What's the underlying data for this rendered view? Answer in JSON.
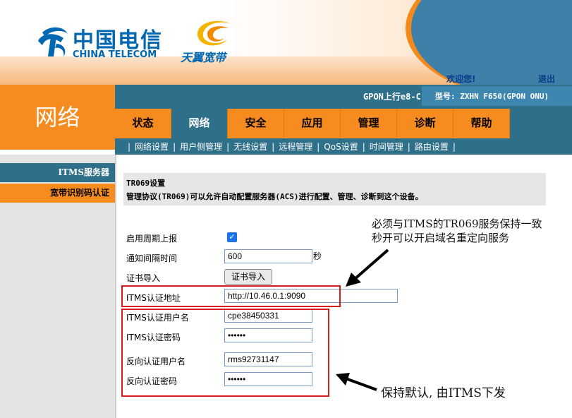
{
  "header": {
    "brand_cn": "中国电信",
    "brand_en": "CHINA TELECOM",
    "sub_brand": "天翼宽带",
    "welcome": "欢迎您!",
    "logout": "退出"
  },
  "section_title": "网络",
  "status_bar": {
    "gpon": "GPON上行e8-C",
    "model": "型号: ZXHN F650(GPON ONU)"
  },
  "nav": {
    "tabs": [
      "状态",
      "网络",
      "安全",
      "应用",
      "管理",
      "诊断",
      "帮助"
    ],
    "active": "网络"
  },
  "subnav": [
    "网络设置",
    "用户侧管理",
    "无线设置",
    "远程管理",
    "QoS设置",
    "时间管理",
    "路由设置"
  ],
  "sidebar": {
    "items": [
      "ITMS服务器",
      "宽带识别码认证"
    ]
  },
  "info": {
    "title": "TR069设置",
    "description": "管理协议(TR069)可以允许自动配置服务器(ACS)进行配置、管理、诊断到这个设备。"
  },
  "form": {
    "periodic_report_label": "启用周期上报",
    "periodic_report_checked": true,
    "notify_interval_label": "通知间隔时间",
    "notify_interval_value": "600",
    "notify_interval_unit": "秒",
    "cert_import_label": "证书导入",
    "cert_import_button": "证书导入",
    "itms_url_label": "ITMS认证地址",
    "itms_url_value": "http://10.46.0.1:9090",
    "itms_user_label": "ITMS认证用户名",
    "itms_user_value": "cpe38450331",
    "itms_pass_label": "ITMS认证密码",
    "itms_pass_value": "••••••",
    "reverse_user_label": "反向认证用户名",
    "reverse_user_value": "rms92731147",
    "reverse_pass_label": "反向认证密码",
    "reverse_pass_value": "••••••"
  },
  "annotations": {
    "note_top_line1": "必须与ITMS的TR069服务保持一致",
    "note_top_line2": "秒开可以开启域名重定向服务",
    "note_bottom": "保持默认, 由ITMS下发"
  },
  "colors": {
    "orange": "#f68b1f",
    "teal": "#2e6f89",
    "brand_blue": "#0067b1",
    "annotation_red": "#d81b1b"
  }
}
